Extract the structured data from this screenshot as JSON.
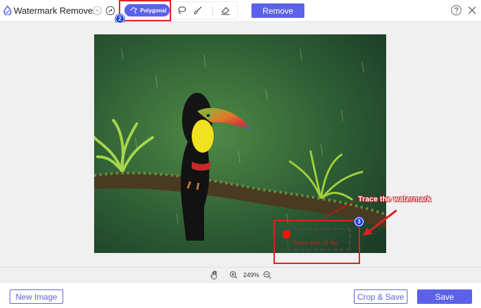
{
  "app": {
    "title": "Watermark Remover",
    "logo_icon": "water-drop-logo-icon"
  },
  "toolbar": {
    "undo_icon": "undo-icon",
    "redo_icon": "redo-icon",
    "tools": [
      {
        "label": "Polygonal",
        "icon": "polygon-lasso-icon",
        "selected": true
      },
      {
        "label": "",
        "icon": "lasso-icon",
        "selected": false
      },
      {
        "label": "",
        "icon": "brush-icon",
        "selected": false
      },
      {
        "label": "",
        "icon": "eraser-icon",
        "selected": false
      }
    ],
    "remove_label": "Remove",
    "help_icon": "help-icon",
    "close_icon": "close-icon"
  },
  "annotations": {
    "step_2": "2",
    "step_3": "3",
    "trace_label": "Trace the watermark",
    "watermark_text": "Some part of the"
  },
  "zoom": {
    "level": "249%",
    "hand_icon": "hand-pan-icon",
    "zoom_in_icon": "zoom-in-icon",
    "zoom_out_icon": "zoom-out-icon"
  },
  "footer": {
    "new_image_label": "New Image",
    "crop_save_label": "Crop & Save",
    "save_label": "Save"
  },
  "colors": {
    "accent": "#5b62e8",
    "highlight": "#e02020",
    "badge": "#1d3fd8"
  }
}
